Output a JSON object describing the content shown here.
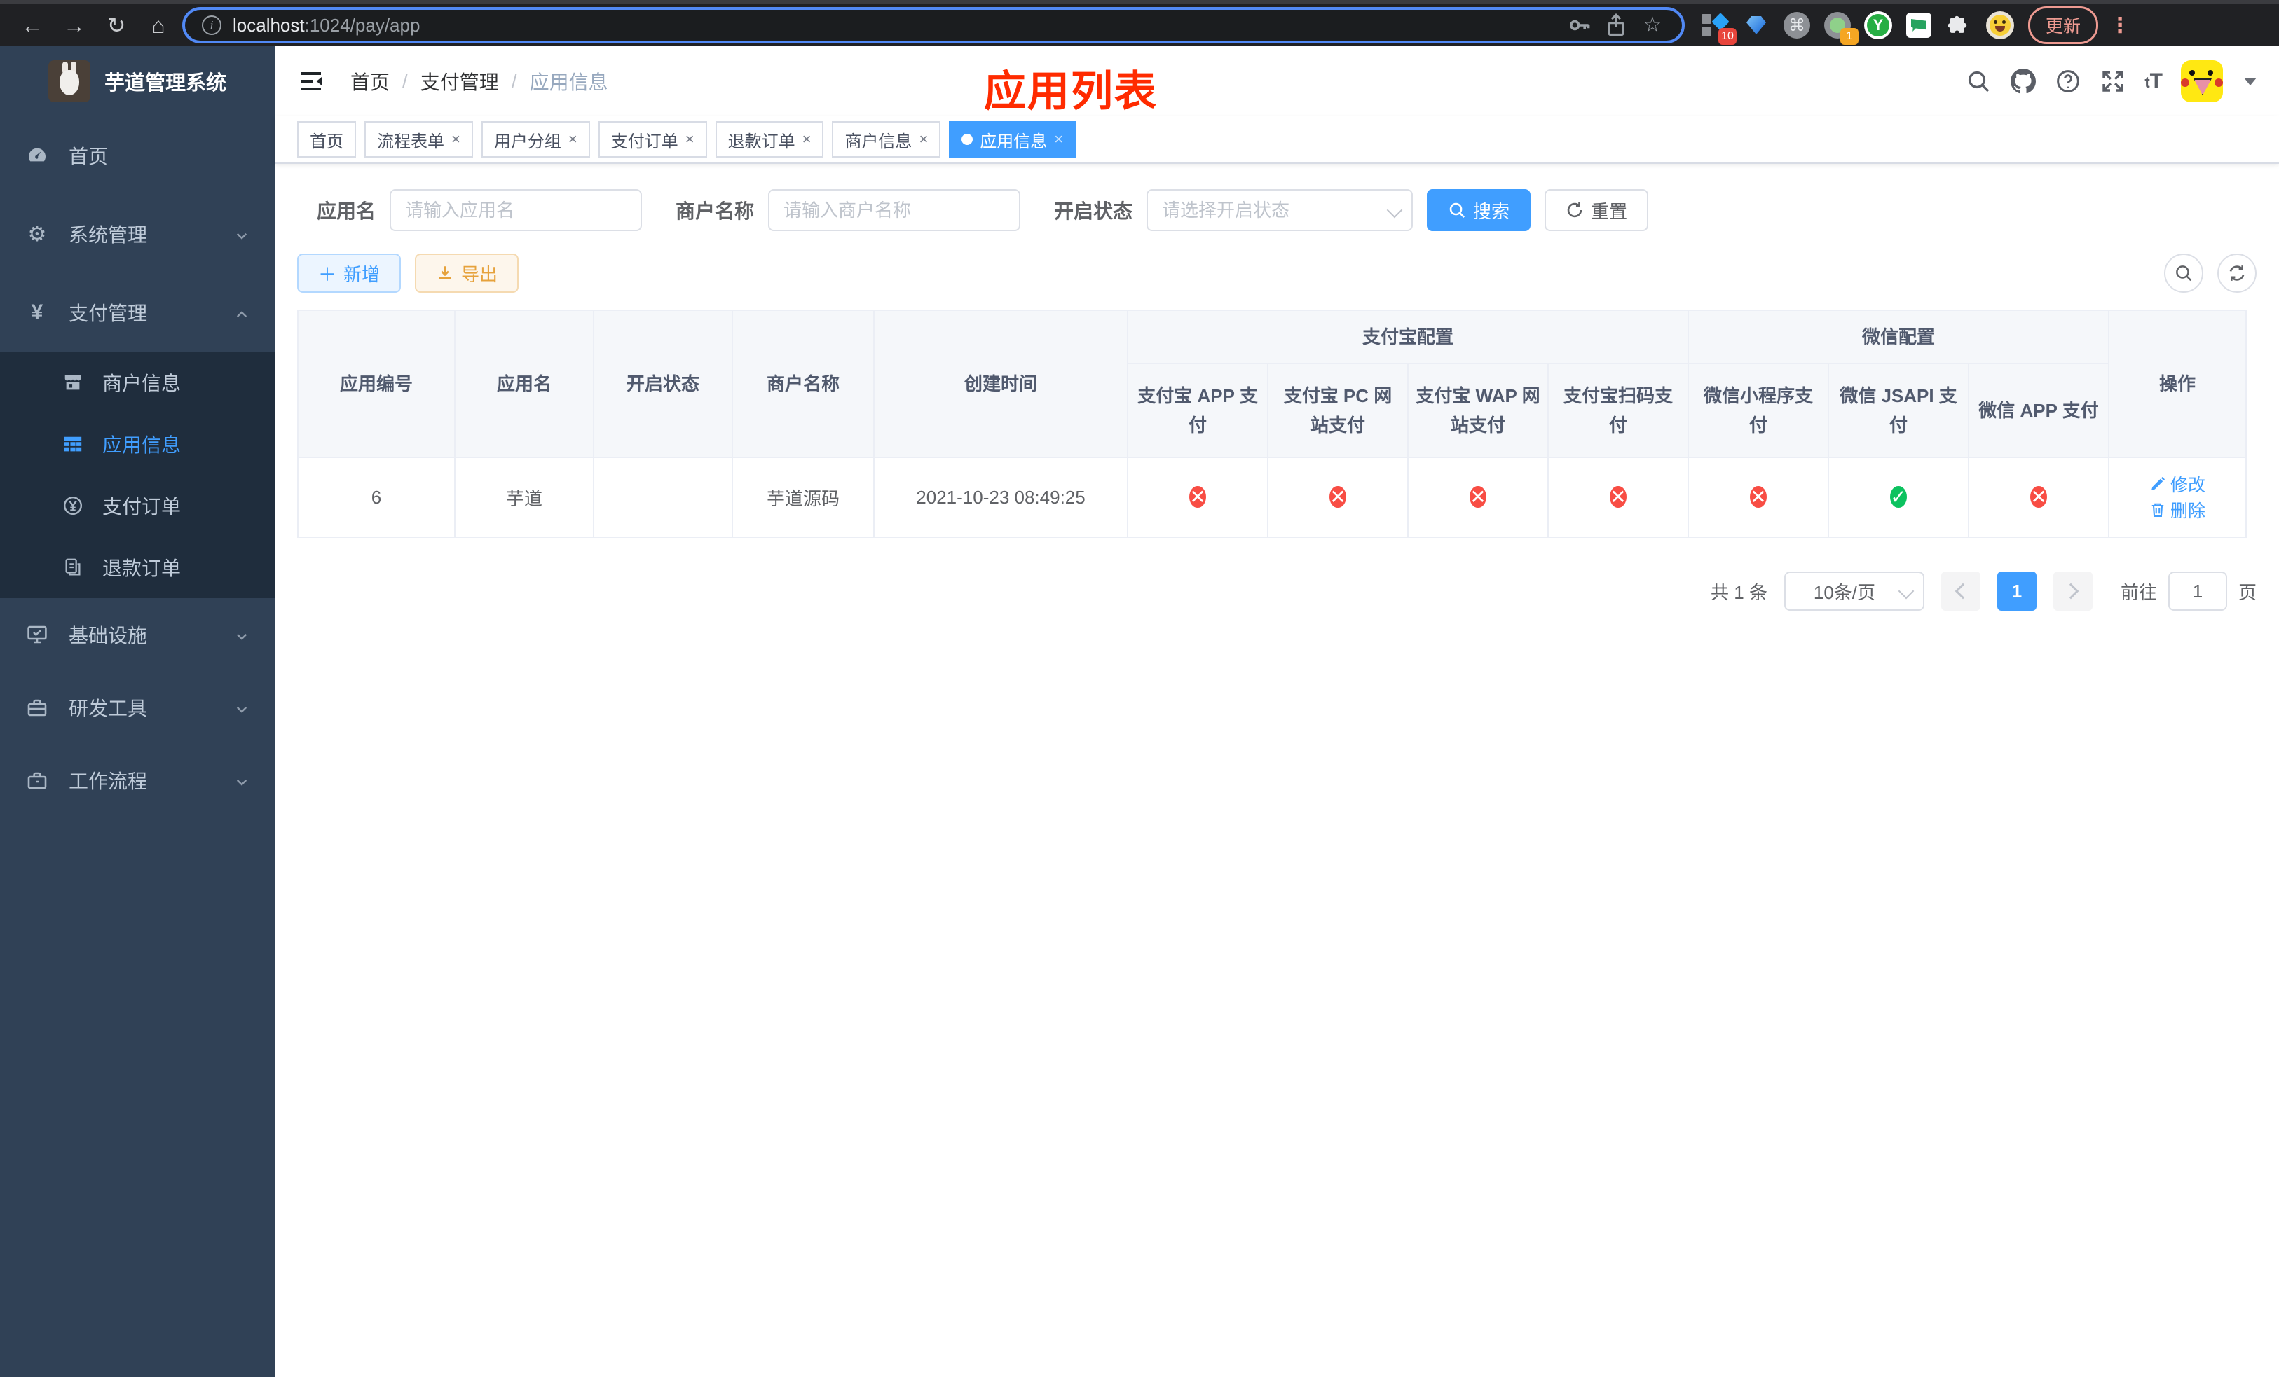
{
  "browser": {
    "url_host": "localhost",
    "url_rest": ":1024/pay/app",
    "update_label": "更新",
    "ext_badge_count_1": "10",
    "ext_badge_count_2": "1",
    "ext_y_letter": "Y"
  },
  "sidebar": {
    "title": "芋道管理系统",
    "items": [
      {
        "label": "首页"
      },
      {
        "label": "系统管理"
      },
      {
        "label": "支付管理",
        "children": [
          {
            "label": "商户信息"
          },
          {
            "label": "应用信息"
          },
          {
            "label": "支付订单"
          },
          {
            "label": "退款订单"
          }
        ]
      },
      {
        "label": "基础设施"
      },
      {
        "label": "研发工具"
      },
      {
        "label": "工作流程"
      }
    ]
  },
  "header": {
    "breadcrumb": [
      "首页",
      "支付管理",
      "应用信息"
    ],
    "breadcrumb_separator": "/",
    "annotation": "应用列表",
    "font_size_icon_text_small": "t",
    "font_size_icon_text_big": "T"
  },
  "tabs": [
    {
      "label": "首页"
    },
    {
      "label": "流程表单"
    },
    {
      "label": "用户分组"
    },
    {
      "label": "支付订单"
    },
    {
      "label": "退款订单"
    },
    {
      "label": "商户信息"
    },
    {
      "label": "应用信息"
    }
  ],
  "filters": {
    "app_name_label": "应用名",
    "app_name_placeholder": "请输入应用名",
    "merchant_name_label": "商户名称",
    "merchant_name_placeholder": "请输入商户名称",
    "status_label": "开启状态",
    "status_placeholder": "请选择开启状态",
    "search_label": "搜索",
    "reset_label": "重置"
  },
  "toolbar": {
    "add_label": "新增",
    "export_label": "导出"
  },
  "table": {
    "headers": {
      "app_id": "应用编号",
      "app_name": "应用名",
      "status": "开启状态",
      "merchant": "商户名称",
      "created": "创建时间",
      "alipay_group": "支付宝配置",
      "wechat_group": "微信配置",
      "channels": [
        "支付宝 APP 支付",
        "支付宝 PC 网站支付",
        "支付宝 WAP 网站支付",
        "支付宝扫码支付",
        "微信小程序支付",
        "微信 JSAPI 支付",
        "微信 APP 支付"
      ],
      "actions": "操作"
    },
    "rows": [
      {
        "app_id": "6",
        "app_name": "芋道",
        "enabled": true,
        "merchant": "芋道源码",
        "created": "2021-10-23 08:49:25",
        "channel_status": [
          "off",
          "off",
          "off",
          "off",
          "off",
          "on",
          "off"
        ],
        "edit_label": "修改",
        "delete_label": "删除"
      }
    ]
  },
  "pagination": {
    "total_label": "共 1 条",
    "page_size_label": "10条/页",
    "current_page": "1",
    "goto_label": "前往",
    "goto_value": "1",
    "page_suffix": "页"
  },
  "icons": {
    "close": "×",
    "cross": "✕",
    "check": "✓",
    "plus": "＋",
    "back": "←",
    "forward": "→",
    "reload": "↻",
    "home": "⌂",
    "star": "☆",
    "command": "⌘",
    "dots_vertical": "⋮",
    "yen": "¥",
    "gear": "⚙",
    "info": "i",
    "question": "?"
  },
  "colors": {
    "accent": "#409eff",
    "danger": "#f84d44",
    "success": "#0cc25f",
    "warning": "#e6a23c",
    "annotation_red": "#ff2b00",
    "sidebar_bg": "#304156",
    "submenu_bg": "#1f2d3d"
  }
}
